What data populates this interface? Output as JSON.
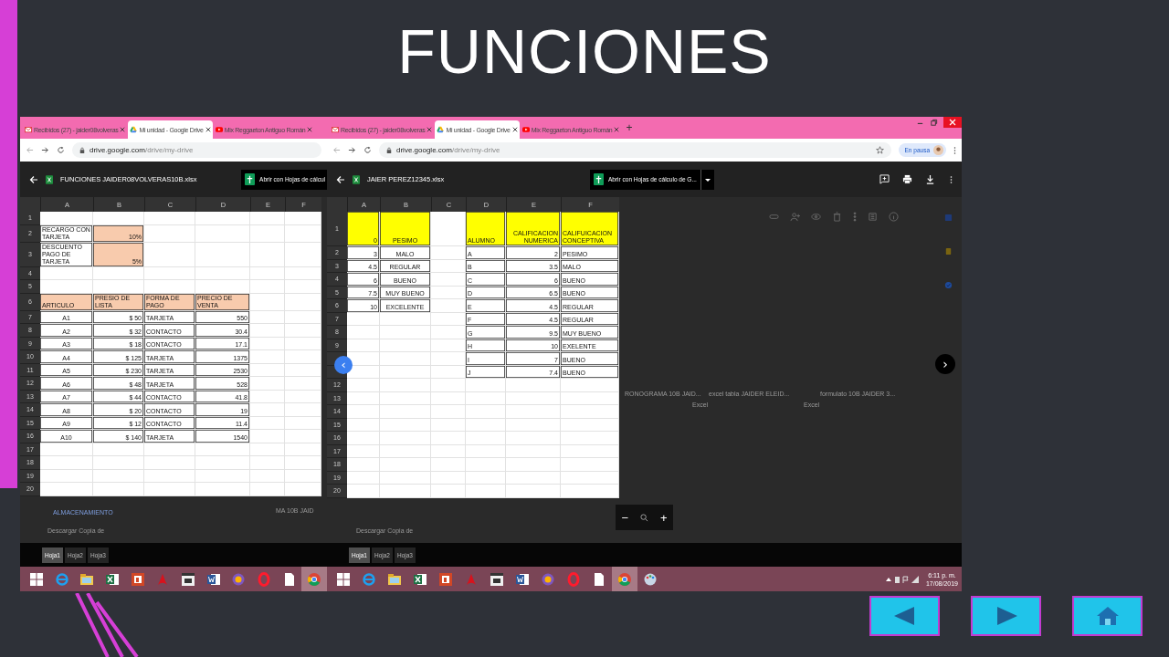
{
  "slide_title": "FUNCIONES",
  "panes": [
    {
      "browser_tabs": [
        {
          "label": "Recibidos (27) - jaider08volveras",
          "kind": "mail",
          "selected": false
        },
        {
          "label": "Mi unidad - Google Drive",
          "kind": "drive",
          "selected": true
        },
        {
          "label": "Mix Reggaeton Antiguo Román",
          "kind": "youtube",
          "selected": false
        }
      ],
      "url": {
        "host": "drive.google.com",
        "path": "/drive/my-drive"
      },
      "file_name": "FUNCIONES JAIDER08VOLVERAS10B.xlsx",
      "open_with": "Abrir con Hojas de cálcul",
      "columns": [
        "A",
        "B",
        "C",
        "D",
        "E",
        "F"
      ],
      "rows": [
        {
          "n": "1"
        },
        {
          "n": "2",
          "cells": [
            {
              "t": "RECARGO CON TARJETA"
            },
            {
              "t": "10%",
              "color": "#f8cbad"
            }
          ]
        },
        {
          "n": "3",
          "cells": [
            {
              "t": "DESCUENTO PAGO DE TARJETA"
            },
            {
              "t": "5%",
              "color": "#f8cbad"
            }
          ]
        },
        {
          "n": "4"
        },
        {
          "n": "5"
        },
        {
          "n": "6",
          "cells": [
            {
              "t": "ARTICULO",
              "color": "#f8cbad"
            },
            {
              "t": "PRESIO DE LISTA",
              "color": "#f8cbad"
            },
            {
              "t": "FORMA DE PAGO",
              "color": "#f8cbad"
            },
            {
              "t": "PRECIO DE VENTA",
              "color": "#f8cbad"
            }
          ]
        },
        {
          "n": "7",
          "cells": [
            {
              "t": "A1"
            },
            {
              "t": "$ 50"
            },
            {
              "t": "TARJETA"
            },
            {
              "t": "550"
            }
          ]
        },
        {
          "n": "8",
          "cells": [
            {
              "t": "A2"
            },
            {
              "t": "$ 32"
            },
            {
              "t": "CONTACTO"
            },
            {
              "t": "30.4"
            }
          ]
        },
        {
          "n": "9",
          "cells": [
            {
              "t": "A3"
            },
            {
              "t": "$ 18"
            },
            {
              "t": "CONTACTO"
            },
            {
              "t": "17.1"
            }
          ]
        },
        {
          "n": "10",
          "cells": [
            {
              "t": "A4"
            },
            {
              "t": "$ 125"
            },
            {
              "t": "TARJETA"
            },
            {
              "t": "1375"
            }
          ]
        },
        {
          "n": "11",
          "cells": [
            {
              "t": "A5"
            },
            {
              "t": "$ 230"
            },
            {
              "t": "TARJETA"
            },
            {
              "t": "2530"
            }
          ]
        },
        {
          "n": "12",
          "cells": [
            {
              "t": "A6"
            },
            {
              "t": "$ 48"
            },
            {
              "t": "TARJETA"
            },
            {
              "t": "528"
            }
          ]
        },
        {
          "n": "13",
          "cells": [
            {
              "t": "A7"
            },
            {
              "t": "$ 44"
            },
            {
              "t": "CONTACTO"
            },
            {
              "t": "41.8"
            }
          ]
        },
        {
          "n": "14",
          "cells": [
            {
              "t": "A8"
            },
            {
              "t": "$ 20"
            },
            {
              "t": "CONTACTO"
            },
            {
              "t": "19"
            }
          ]
        },
        {
          "n": "15",
          "cells": [
            {
              "t": "A9"
            },
            {
              "t": "$ 12"
            },
            {
              "t": "CONTACTO"
            },
            {
              "t": "11.4"
            }
          ]
        },
        {
          "n": "16",
          "cells": [
            {
              "t": "A10"
            },
            {
              "t": "$ 140"
            },
            {
              "t": "TARJETA"
            },
            {
              "t": "1540"
            }
          ]
        },
        {
          "n": "17"
        },
        {
          "n": "18"
        },
        {
          "n": "19"
        },
        {
          "n": "20"
        }
      ],
      "background_texts": [
        {
          "t": "ALMACENAMIENTO",
          "kind": "section"
        },
        {
          "t": "MA 10B JAID",
          "kind": "card"
        },
        {
          "t": "Descargar Copia de",
          "kind": "download"
        }
      ],
      "sheet_tabs": [
        {
          "label": "Hoja1",
          "selected": true
        },
        {
          "label": "Hoja2",
          "selected": false
        },
        {
          "label": "Hoja3",
          "selected": false
        }
      ],
      "taskbar": [
        {
          "kind": "windows",
          "selected": false
        },
        {
          "kind": "ie",
          "selected": false
        },
        {
          "kind": "explorer",
          "selected": false
        },
        {
          "kind": "excel",
          "selected": false
        },
        {
          "kind": "powerpoint",
          "selected": false
        },
        {
          "kind": "pdf",
          "selected": false
        },
        {
          "kind": "media",
          "selected": false
        },
        {
          "kind": "word",
          "selected": false
        },
        {
          "kind": "vpn",
          "selected": false
        },
        {
          "kind": "opera",
          "selected": false
        },
        {
          "kind": "file",
          "selected": false
        },
        {
          "kind": "chrome",
          "selected": true
        }
      ]
    },
    {
      "browser_tabs": [
        {
          "label": "Recibidos (27) - jaider08volveras",
          "kind": "mail",
          "selected": false
        },
        {
          "label": "Mi unidad - Google Drive",
          "kind": "drive",
          "selected": true
        },
        {
          "label": "Mix Reggaeton Antiguo Román",
          "kind": "youtube",
          "selected": false
        }
      ],
      "new_tab": "+",
      "url": {
        "host": "drive.google.com",
        "path": "/drive/my-drive"
      },
      "profile": "En pausa",
      "file_name": "JAIER PEREZ12345.xlsx",
      "open_with": "Abrir con Hojas de cálculo de G...",
      "columns": [
        "A",
        "B",
        "C",
        "D",
        "E",
        "F"
      ],
      "rows": [
        {
          "n": "1",
          "cells": [
            {
              "t": "0",
              "color": "#ffff00"
            },
            {
              "t": "PESIMO",
              "color": "#ffff00"
            },
            null,
            {
              "t": "ALUMNO",
              "color": "#ffff00"
            },
            {
              "t": "CALIFICACION NUMERICA",
              "color": "#ffff00"
            },
            {
              "t": "CALIFUICACION CONCEPTIVA",
              "color": "#ffff00"
            }
          ]
        },
        {
          "n": "2",
          "cells": [
            {
              "t": "3"
            },
            {
              "t": "MALO"
            },
            null,
            {
              "t": "A"
            },
            {
              "t": "2"
            },
            {
              "t": "PESIMO"
            }
          ]
        },
        {
          "n": "3",
          "cells": [
            {
              "t": "4.5"
            },
            {
              "t": "REGULAR"
            },
            null,
            {
              "t": "B"
            },
            {
              "t": "3.5"
            },
            {
              "t": "MALO"
            }
          ]
        },
        {
          "n": "4",
          "cells": [
            {
              "t": "6"
            },
            {
              "t": "BUENO"
            },
            null,
            {
              "t": "C"
            },
            {
              "t": "6"
            },
            {
              "t": "BUENO"
            }
          ]
        },
        {
          "n": "5",
          "cells": [
            {
              "t": "7.5"
            },
            {
              "t": "MUY BUENO"
            },
            null,
            {
              "t": "D"
            },
            {
              "t": "6.5"
            },
            {
              "t": "BUENO"
            }
          ]
        },
        {
          "n": "6",
          "cells": [
            {
              "t": "10"
            },
            {
              "t": "EXCELENTE"
            },
            null,
            {
              "t": "E"
            },
            {
              "t": "4.5"
            },
            {
              "t": "REGULAR"
            }
          ]
        },
        {
          "n": "7",
          "cells": [
            null,
            null,
            null,
            {
              "t": "F"
            },
            {
              "t": "4.5"
            },
            {
              "t": "REGULAR"
            }
          ]
        },
        {
          "n": "8",
          "cells": [
            null,
            null,
            null,
            {
              "t": "G"
            },
            {
              "t": "9.5"
            },
            {
              "t": "MUY BUENO"
            }
          ]
        },
        {
          "n": "9",
          "cells": [
            null,
            null,
            null,
            {
              "t": "H"
            },
            {
              "t": "10"
            },
            {
              "t": "EXELENTE"
            }
          ]
        },
        {
          "cells": [
            null,
            null,
            null,
            {
              "t": "I"
            },
            {
              "t": "7"
            },
            {
              "t": "BUENO"
            }
          ]
        },
        {
          "cells": [
            null,
            null,
            null,
            {
              "t": "J"
            },
            {
              "t": "7.4"
            },
            {
              "t": "BUENO"
            }
          ]
        },
        {
          "n": "12"
        },
        {
          "n": "13"
        },
        {
          "n": "14"
        },
        {
          "n": "15"
        },
        {
          "n": "16"
        },
        {
          "n": "17"
        },
        {
          "n": "18"
        },
        {
          "n": "19"
        },
        {
          "n": "20"
        }
      ],
      "background_texts": [
        {
          "t": "Descargar Copia de",
          "kind": "download"
        },
        {
          "t": "RONOGRAMA 10B JAID...",
          "kind": "card"
        },
        {
          "t": "excel tabla JAIDER ELEID...",
          "kind": "card2"
        },
        {
          "t": "Excel",
          "kind": "sub2"
        },
        {
          "t": "formulato 10B JAIDER 3...",
          "kind": "card3"
        },
        {
          "t": "Excel",
          "kind": "sub3"
        }
      ],
      "prev_button": "‹",
      "next_button": "›",
      "zoom": {
        "minus": "−",
        "plus": "+"
      },
      "sheet_tabs": [
        {
          "label": "Hoja1",
          "selected": true
        },
        {
          "label": "Hoja2",
          "selected": false
        },
        {
          "label": "Hoja3",
          "selected": false
        }
      ],
      "taskbar": [
        {
          "kind": "windows",
          "selected": false
        },
        {
          "kind": "ie",
          "selected": false
        },
        {
          "kind": "explorer",
          "selected": false
        },
        {
          "kind": "excel",
          "selected": false
        },
        {
          "kind": "powerpoint",
          "selected": false
        },
        {
          "kind": "pdf",
          "selected": false
        },
        {
          "kind": "media",
          "selected": false
        },
        {
          "kind": "word",
          "selected": false
        },
        {
          "kind": "vpn",
          "selected": false
        },
        {
          "kind": "opera",
          "selected": false
        },
        {
          "kind": "file",
          "selected": false
        },
        {
          "kind": "chrome",
          "selected": true
        },
        {
          "kind": "paint",
          "selected": false
        }
      ],
      "clock": {
        "time": "6:11 p. m.",
        "date": "17/08/2019"
      }
    }
  ],
  "nav_buttons": [
    {
      "kind": "prev"
    },
    {
      "kind": "next"
    },
    {
      "kind": "home"
    }
  ]
}
